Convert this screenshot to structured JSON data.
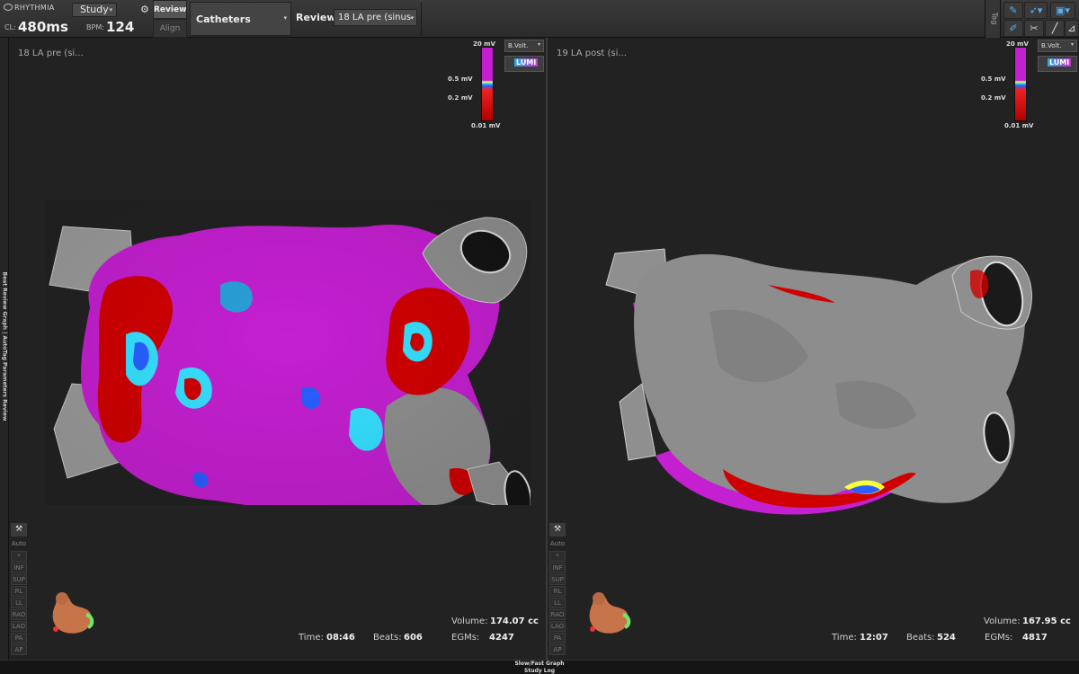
{
  "header": {
    "logo_text": "RHYTHMIA",
    "cl_label": "CL:",
    "cl_value": "480ms",
    "bpm_label": "BPM:",
    "bpm_value": "124",
    "study_label": "Study",
    "review_tab": "Review",
    "align_tab": "Align",
    "catheters_label": "Catheters",
    "review_label": "Review:",
    "review_selected": "18 LA pre (sinus-",
    "tag_label": "Tag"
  },
  "left_strip_text": "Beat Review Graph | AutoTag Parameters Review",
  "panes": [
    {
      "title": "18 LA pre (si...",
      "voltage_select": "B.Volt.",
      "lumi_label": "LUMI",
      "scale": [
        "20 mV",
        "0.5 mV",
        "0.2 mV",
        "0.01 mV"
      ],
      "side_buttons": [
        "Auto",
        "*",
        "INF",
        "SUP",
        "RL",
        "LL",
        "RAO",
        "LAO",
        "PA",
        "AP"
      ],
      "volume_label": "Volume:",
      "volume_value": "174.07 cc",
      "time_label": "Time:",
      "time_value": "08:46",
      "beats_label": "Beats:",
      "beats_value": "606",
      "egms_label": "EGMs:",
      "egms_value": "4247"
    },
    {
      "title": "19 LA post (si...",
      "voltage_select": "B.Volt.",
      "lumi_label": "LUMI",
      "scale": [
        "20 mV",
        "0.5 mV",
        "0.2 mV",
        "0.01 mV"
      ],
      "side_buttons": [
        "Auto",
        "*",
        "INF",
        "SUP",
        "RL",
        "LL",
        "RAO",
        "LAO",
        "PA",
        "AP"
      ],
      "volume_label": "Volume:",
      "volume_value": "167.95 cc",
      "time_label": "Time:",
      "time_value": "12:07",
      "beats_label": "Beats:",
      "beats_value": "524",
      "egms_label": "EGMs:",
      "egms_value": "4817"
    }
  ],
  "footer": {
    "line1": "Slow/Fast Graph",
    "line2": "Study Log"
  },
  "colors": {
    "healthy": "#c41fd0",
    "scar": "#d00000",
    "border_zone": "#35e0ff",
    "unmapped": "#8d8d8d"
  }
}
